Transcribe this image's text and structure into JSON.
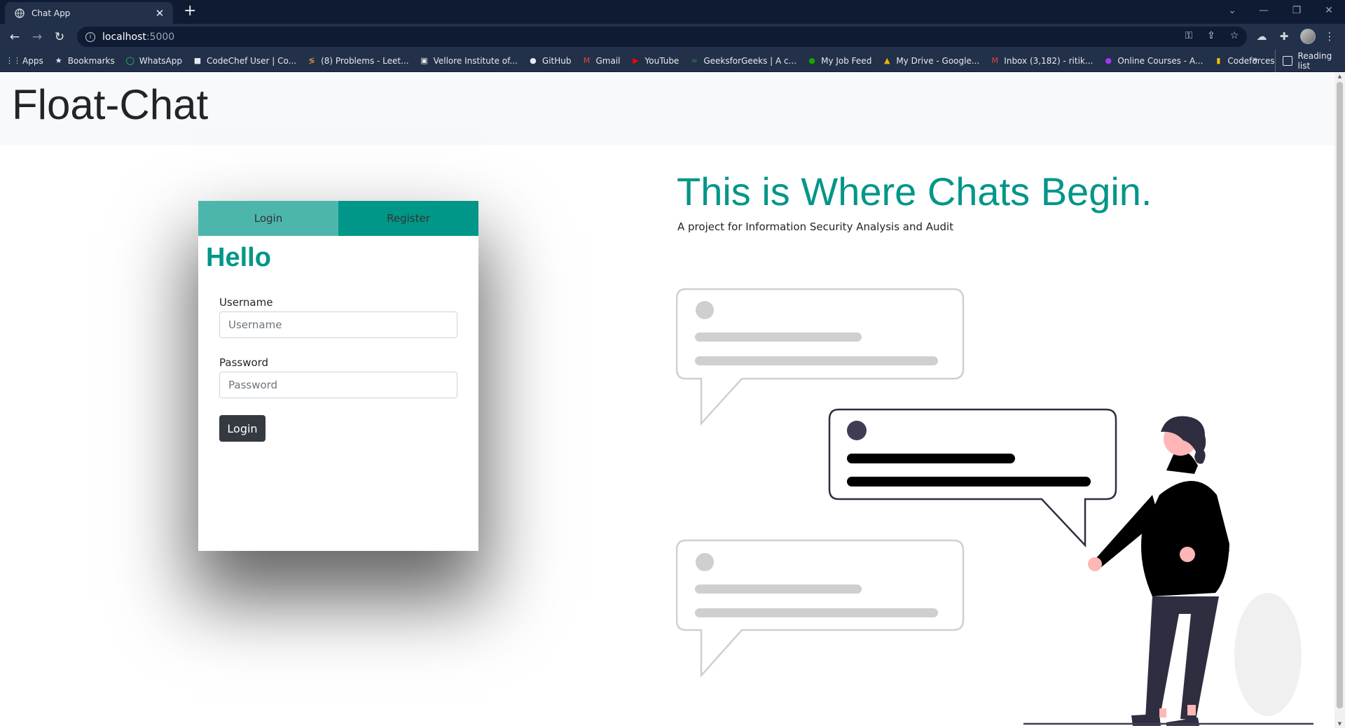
{
  "browser": {
    "tab_title": "Chat App",
    "address_host": "localhost",
    "address_port": ":5000",
    "bookmarks": [
      {
        "label": "Apps",
        "icon": "apps-grid-icon",
        "color": "#e8eaed"
      },
      {
        "label": "Bookmarks",
        "icon": "star-icon",
        "color": "#e8eaed"
      },
      {
        "label": "WhatsApp",
        "icon": "whatsapp-icon",
        "color": "#25d366"
      },
      {
        "label": "CodeChef User | Co...",
        "icon": "codechef-icon",
        "color": "#e8eaed"
      },
      {
        "label": "(8) Problems - Leet...",
        "icon": "leetcode-icon",
        "color": "#f0a13a"
      },
      {
        "label": "Vellore Institute of...",
        "icon": "vit-icon",
        "color": "#e8eaed"
      },
      {
        "label": "GitHub",
        "icon": "github-icon",
        "color": "#e8eaed"
      },
      {
        "label": "Gmail",
        "icon": "gmail-icon",
        "color": "#ea4335"
      },
      {
        "label": "YouTube",
        "icon": "youtube-icon",
        "color": "#ff0000"
      },
      {
        "label": "GeeksforGeeks | A c...",
        "icon": "gfg-icon",
        "color": "#2f8d46"
      },
      {
        "label": "My Job Feed",
        "icon": "upwork-icon",
        "color": "#14a800"
      },
      {
        "label": "My Drive - Google...",
        "icon": "drive-icon",
        "color": "#f4b400"
      },
      {
        "label": "Inbox (3,182) - ritik...",
        "icon": "gmail-icon",
        "color": "#ea4335"
      },
      {
        "label": "Online Courses - A...",
        "icon": "courses-icon",
        "color": "#a435f0"
      },
      {
        "label": "Codeforces",
        "icon": "codeforces-icon",
        "color": "#f4c20d"
      }
    ],
    "reading_list": "Reading list"
  },
  "navbar": {
    "brand": "Float-Chat"
  },
  "auth": {
    "tab_login": "Login",
    "tab_register": "Register",
    "greeting": "Hello",
    "username_label": "Username",
    "username_placeholder": "Username",
    "password_label": "Password",
    "password_placeholder": "Password",
    "submit": "Login"
  },
  "hero": {
    "headline": "This is Where Chats Begin.",
    "subtitle": "A project for Information Security Analysis and Audit"
  },
  "colors": {
    "accent": "#009688",
    "accent_light": "#4db6ac",
    "dark_button": "#343a40"
  }
}
